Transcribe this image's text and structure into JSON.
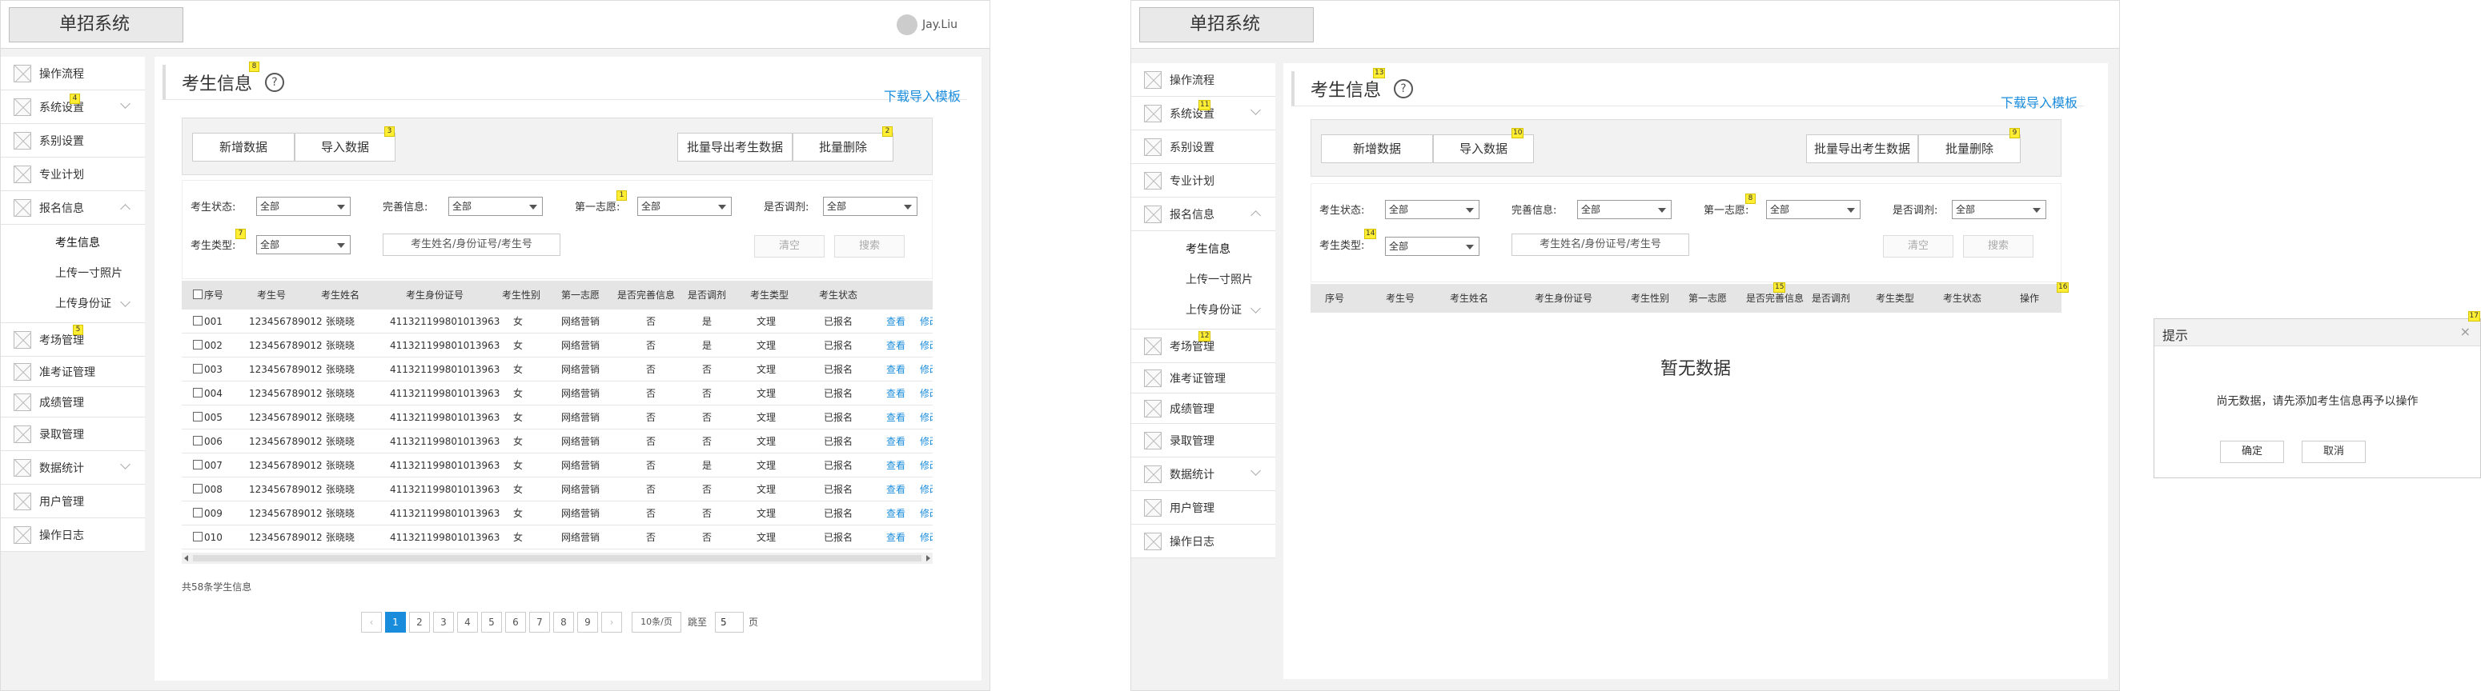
{
  "app": {
    "logo": "单招系统",
    "user": "Jay.Liu"
  },
  "sidebar": {
    "items": [
      {
        "label": "操作流程"
      },
      {
        "label": "系统设置"
      },
      {
        "label": "系别设置"
      },
      {
        "label": "专业计划"
      },
      {
        "label": "报名信息"
      },
      {
        "label": "考场管理"
      },
      {
        "label": "准考证管理"
      },
      {
        "label": "成绩管理"
      },
      {
        "label": "录取管理"
      },
      {
        "label": "数据统计"
      },
      {
        "label": "用户管理"
      },
      {
        "label": "操作日志"
      }
    ],
    "subitems": [
      {
        "label": "考生信息"
      },
      {
        "label": "上传一寸照片"
      },
      {
        "label": "上传身份证"
      }
    ]
  },
  "page": {
    "title": "考生信息",
    "help": "?",
    "download_link": "下载导入模板",
    "buttons": {
      "add": "新增数据",
      "import": "导入数据",
      "export": "批量导出考生数据",
      "delete": "批量删除"
    },
    "filters": {
      "status_label": "考生状态:",
      "complete_label": "完善信息:",
      "first_choice_label": "第一志愿:",
      "adjust_label": "是否调剂:",
      "type_label": "考生类型:",
      "all": "全部",
      "search_placeholder": "考生姓名/身份证号/考生号",
      "clear": "清空",
      "search": "搜索"
    },
    "columns_left": [
      "序号",
      "考生号",
      "考生姓名",
      "考生身份证号",
      "考生性别",
      "第一志愿",
      "是否完善信息",
      "是否调剂",
      "考生类型",
      "考生状态"
    ],
    "columns_right": [
      "序号",
      "考生号",
      "考生姓名",
      "考生身份证号",
      "考生性别",
      "第一志愿",
      "是否完善信息",
      "是否调剂",
      "考生类型",
      "考生状态",
      "操作"
    ],
    "rows": [
      {
        "no": "001",
        "id": "123456789012",
        "name": "张晓晓",
        "idcard": "411321199801013963",
        "gender": "女",
        "choice": "网络营销",
        "complete": "否",
        "adjust": "是",
        "type": "文理",
        "status": "已报名"
      },
      {
        "no": "002",
        "id": "123456789012",
        "name": "张晓晓",
        "idcard": "411321199801013963",
        "gender": "女",
        "choice": "网络营销",
        "complete": "否",
        "adjust": "是",
        "type": "文理",
        "status": "已报名"
      },
      {
        "no": "003",
        "id": "123456789012",
        "name": "张晓晓",
        "idcard": "411321199801013963",
        "gender": "女",
        "choice": "网络营销",
        "complete": "否",
        "adjust": "否",
        "type": "文理",
        "status": "已报名"
      },
      {
        "no": "004",
        "id": "123456789012",
        "name": "张晓晓",
        "idcard": "411321199801013963",
        "gender": "女",
        "choice": "网络营销",
        "complete": "否",
        "adjust": "否",
        "type": "文理",
        "status": "已报名"
      },
      {
        "no": "005",
        "id": "123456789012",
        "name": "张晓晓",
        "idcard": "411321199801013963",
        "gender": "女",
        "choice": "网络营销",
        "complete": "否",
        "adjust": "否",
        "type": "文理",
        "status": "已报名"
      },
      {
        "no": "006",
        "id": "123456789012",
        "name": "张晓晓",
        "idcard": "411321199801013963",
        "gender": "女",
        "choice": "网络营销",
        "complete": "否",
        "adjust": "否",
        "type": "文理",
        "status": "已报名"
      },
      {
        "no": "007",
        "id": "123456789012",
        "name": "张晓晓",
        "idcard": "411321199801013963",
        "gender": "女",
        "choice": "网络营销",
        "complete": "否",
        "adjust": "是",
        "type": "文理",
        "status": "已报名"
      },
      {
        "no": "008",
        "id": "123456789012",
        "name": "张晓晓",
        "idcard": "411321199801013963",
        "gender": "女",
        "choice": "网络营销",
        "complete": "否",
        "adjust": "否",
        "type": "文理",
        "status": "已报名"
      },
      {
        "no": "009",
        "id": "123456789012",
        "name": "张晓晓",
        "idcard": "411321199801013963",
        "gender": "女",
        "choice": "网络营销",
        "complete": "否",
        "adjust": "否",
        "type": "文理",
        "status": "已报名"
      },
      {
        "no": "010",
        "id": "123456789012",
        "name": "张晓晓",
        "idcard": "411321199801013963",
        "gender": "女",
        "choice": "网络营销",
        "complete": "否",
        "adjust": "否",
        "type": "文理",
        "status": "已报名"
      }
    ],
    "row_actions": {
      "view": "查看",
      "edit": "修改"
    },
    "total": "共58条学生信息",
    "pagination": {
      "prev": "‹",
      "next": "›",
      "pages": [
        "1",
        "2",
        "3",
        "4",
        "5",
        "6",
        "7",
        "8",
        "9"
      ],
      "page_size": "10条/页",
      "jump_label": "跳至",
      "jump_value": "5",
      "page_unit": "页"
    },
    "empty": "暂无数据"
  },
  "dialog": {
    "title": "提示",
    "close": "×",
    "message": "尚无数据，请先添加考生信息再予以操作",
    "confirm": "确定",
    "cancel": "取消"
  },
  "badges": {
    "l_title": "8",
    "l_import": "3",
    "l_delete": "2",
    "l_first": "1",
    "l_type": "7",
    "l_sys": "4",
    "l_exam": "5",
    "r_title": "13",
    "r_import": "10",
    "r_delete": "9",
    "r_first": "8",
    "r_type": "14",
    "r_sys": "11",
    "r_exam": "12",
    "r_complete": "15",
    "r_op": "16",
    "dialog": "17"
  }
}
